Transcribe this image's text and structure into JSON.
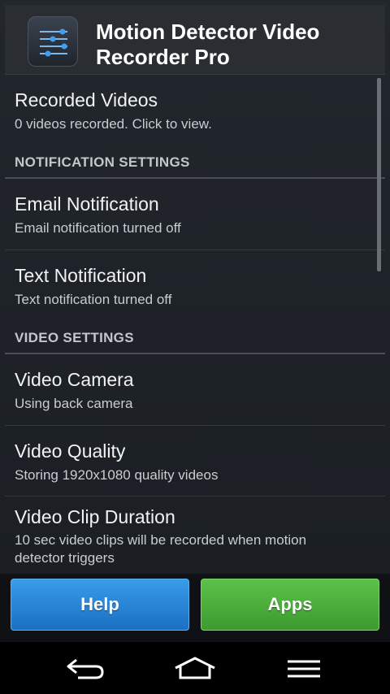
{
  "app": {
    "title": "Motion Detector Video Recorder Pro",
    "icon": "app-sliders-icon"
  },
  "list": {
    "recorded": {
      "title": "Recorded Videos",
      "summary": "0 videos recorded. Click to view."
    },
    "notification_header": "NOTIFICATION SETTINGS",
    "email": {
      "title": "Email Notification",
      "summary": "Email notification turned off"
    },
    "text": {
      "title": "Text Notification",
      "summary": "Text notification turned off"
    },
    "video_header": "VIDEO SETTINGS",
    "camera": {
      "title": "Video Camera",
      "summary": "Using back camera"
    },
    "quality": {
      "title": "Video Quality",
      "summary": "Storing 1920x1080 quality videos"
    },
    "duration": {
      "title": "Video Clip Duration",
      "summary": "10 sec video clips will be recorded when motion detector triggers"
    }
  },
  "buttons": {
    "help": "Help",
    "apps": "Apps"
  },
  "colors": {
    "help": "#2a86d8",
    "apps": "#4caf3a"
  },
  "navbar": {
    "back": "back-icon",
    "home": "home-icon",
    "menu": "menu-icon"
  }
}
